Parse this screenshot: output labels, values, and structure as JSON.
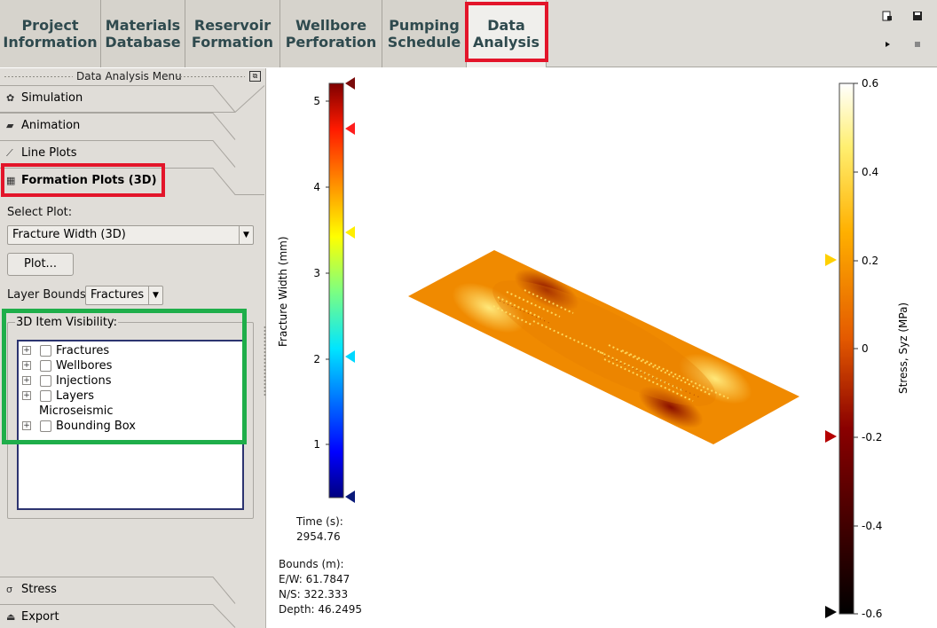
{
  "tabs": [
    {
      "label": "Project\nInformation",
      "active": false
    },
    {
      "label": "Materials\nDatabase",
      "active": false
    },
    {
      "label": "Reservoir\nFormation",
      "active": false
    },
    {
      "label": "Wellbore\nPerforation",
      "active": false
    },
    {
      "label": "Pumping\nSchedule",
      "active": false
    },
    {
      "label": "Data\nAnalysis",
      "active": true
    }
  ],
  "toolbar": {
    "icons": [
      "save-as-icon",
      "save-icon",
      "play-icon",
      "stop-icon"
    ]
  },
  "menu": {
    "title": "Data Analysis Menu",
    "sections": [
      {
        "label": "Simulation",
        "icon": "gear-icon"
      },
      {
        "label": "Animation",
        "icon": "camera-icon"
      },
      {
        "label": "Line Plots",
        "icon": "line-chart-icon"
      },
      {
        "label": "Formation Plots (3D)",
        "icon": "grid-icon",
        "active": true
      }
    ],
    "bottom_sections": [
      {
        "label": "Stress",
        "icon": "sigma-icon"
      },
      {
        "label": "Export",
        "icon": "export-icon"
      }
    ]
  },
  "formation": {
    "select_plot_label": "Select Plot:",
    "select_plot_value": "Fracture Width (3D)",
    "plot_button": "Plot...",
    "layer_bounds_label": "Layer Bounds:",
    "layer_bounds_value": "Fractures",
    "visibility_label": "3D Item Visibility:",
    "tree_items": [
      {
        "label": "Fractures",
        "expandable": true,
        "checkbox": true
      },
      {
        "label": "Wellbores",
        "expandable": true,
        "checkbox": true
      },
      {
        "label": "Injections",
        "expandable": true,
        "checkbox": true
      },
      {
        "label": "Layers",
        "expandable": true,
        "checkbox": true
      },
      {
        "label": "Microseismic",
        "expandable": false,
        "checkbox": false
      },
      {
        "label": "Bounding Box",
        "expandable": true,
        "checkbox": true
      }
    ]
  },
  "viewer": {
    "left_scale": {
      "label": "Fracture Width (mm)",
      "ticks": [
        "5",
        "4",
        "3",
        "2",
        "1"
      ]
    },
    "right_scale": {
      "label": "Stress, Syz (MPa)",
      "ticks": [
        "0.6",
        "0.4",
        "0.2",
        "0",
        "-0.2",
        "-0.4",
        "-0.6"
      ]
    },
    "time_label": "Time (s):",
    "time_value": "2954.76",
    "bounds_label": "Bounds (m):",
    "bounds_ew": "E/W: 61.7847",
    "bounds_ns": "N/S: 322.333",
    "bounds_depth": "Depth: 46.2495"
  },
  "colors": {
    "highlight_red": "#e3152a",
    "highlight_green": "#1fae4a",
    "tab_text": "#2f4a4e"
  }
}
